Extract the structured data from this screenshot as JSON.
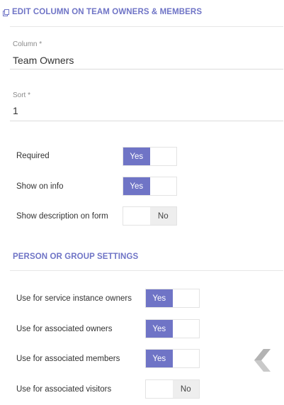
{
  "edit_section": {
    "title": "EDIT COLUMN ON TEAM OWNERS & MEMBERS",
    "icon": "copy-icon"
  },
  "column_field": {
    "label": "Column *",
    "value": "Team Owners"
  },
  "sort_field": {
    "label": "Sort *",
    "value": "1"
  },
  "options": [
    {
      "label": "Required",
      "state": "Yes"
    },
    {
      "label": "Show on info",
      "state": "Yes"
    },
    {
      "label": "Show description on form",
      "state": "No"
    }
  ],
  "person_section": {
    "title": "PERSON OR GROUP SETTINGS"
  },
  "person_options": [
    {
      "label": "Use for service instance owners",
      "state": "Yes"
    },
    {
      "label": "Use for associated owners",
      "state": "Yes"
    },
    {
      "label": "Use for associated members",
      "state": "Yes"
    },
    {
      "label": "Use for associated visitors",
      "state": "No"
    }
  ],
  "toggle_text": {
    "yes": "Yes",
    "no": "No"
  },
  "nav": {
    "icon": "chevron-left-icon"
  },
  "colors": {
    "accent": "#6f74c6",
    "off_fill": "#eeeeee"
  }
}
